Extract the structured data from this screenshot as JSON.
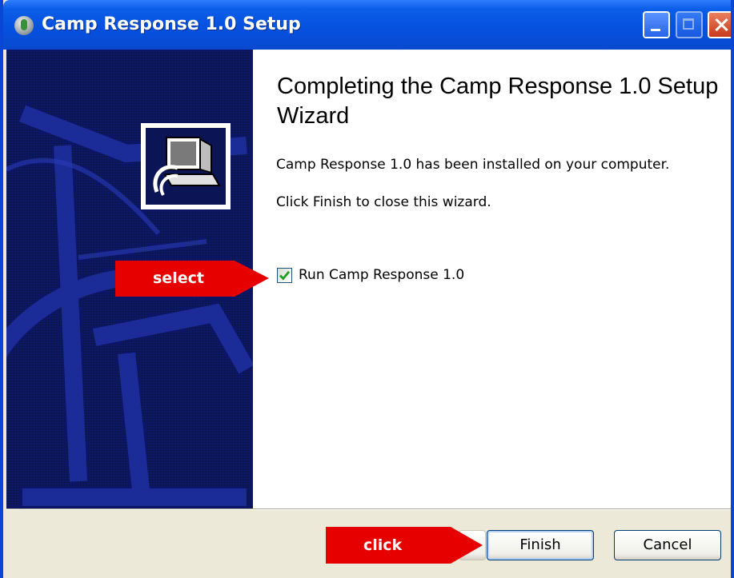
{
  "window": {
    "title": "Camp Response 1.0 Setup",
    "controls": [
      "minimize-icon",
      "maximize-icon",
      "close-icon"
    ]
  },
  "main": {
    "heading": "Completing the Camp Response 1.0 Setup Wizard",
    "installed_text": "Camp Response 1.0 has been installed on your computer.",
    "finish_text": "Click Finish to close this wizard.",
    "run_checkbox": {
      "label": "Run Camp Response 1.0",
      "checked": true
    }
  },
  "buttons": {
    "finish_label": "Finish",
    "cancel_label": "Cancel"
  },
  "annotations": {
    "select_label": "select",
    "click_label": "click"
  },
  "colors": {
    "titlebar": "#0551e0",
    "sidebar": "#0e1a7a",
    "annotation": "#e60000",
    "check": "#21a121"
  }
}
